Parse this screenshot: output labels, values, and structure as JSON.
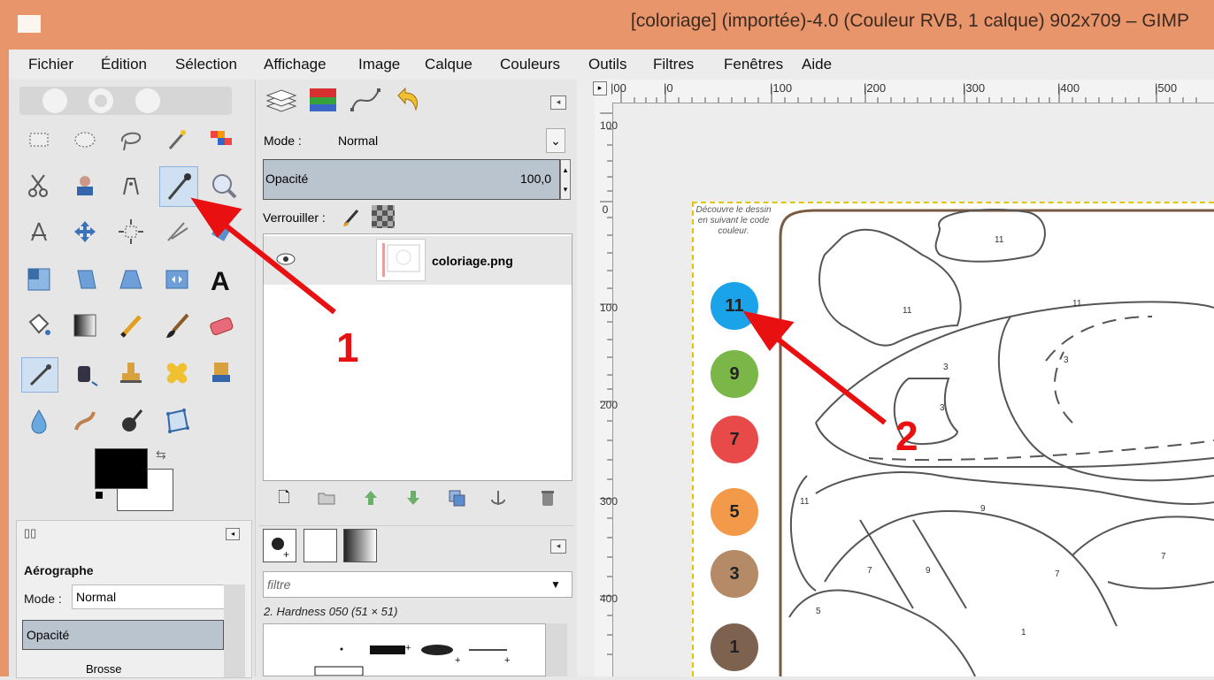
{
  "window": {
    "title": "[coloriage] (importée)-4.0 (Couleur RVB, 1 calque) 902x709 – GIMP"
  },
  "menubar": {
    "items": [
      "Fichier",
      "Édition",
      "Sélection",
      "Affichage",
      "Image",
      "Calque",
      "Couleurs",
      "Outils",
      "Filtres",
      "Fenêtres",
      "Aide"
    ]
  },
  "toolbox": {
    "selected_tool": "color-picker",
    "fg_color": "#000000",
    "bg_color": "#ffffff"
  },
  "tool_options": {
    "title": "Aérographe",
    "mode_label": "Mode :",
    "mode_value": "Normal",
    "opacity_label": "Opacité",
    "brush_label": "Brosse"
  },
  "layers": {
    "mode_label": "Mode :",
    "mode_value": "Normal",
    "opacity_label": "Opacité",
    "opacity_value": "100,0",
    "lock_label": "Verrouiller :",
    "layer_name": "coloriage.png"
  },
  "brushes": {
    "filter_placeholder": "filtre",
    "brush_name": "2. Hardness 050 (51 × 51)"
  },
  "rulers": {
    "top": [
      "|00",
      "|0",
      "|100",
      "|200",
      "|300",
      "|400",
      "|500"
    ],
    "left": [
      "100",
      "0",
      "100",
      "200",
      "300",
      "400"
    ]
  },
  "image": {
    "legend": "Découvre le dessin en suivant le code couleur.",
    "swatches": [
      {
        "label": "11",
        "color": "#1aa3e8"
      },
      {
        "label": "9",
        "color": "#7ab648"
      },
      {
        "label": "7",
        "color": "#e84a4a"
      },
      {
        "label": "5",
        "color": "#f39a4a"
      },
      {
        "label": "3",
        "color": "#b58a66"
      },
      {
        "label": "1",
        "color": "#7d6250"
      }
    ],
    "region_numbers": [
      "11",
      "11",
      "11",
      "3",
      "3",
      "3",
      "11",
      "9",
      "7",
      "9",
      "7",
      "7",
      "5",
      "1"
    ]
  },
  "annotations": {
    "arrow1_label": "1",
    "arrow2_label": "2",
    "arrow_color": "#e81010"
  }
}
